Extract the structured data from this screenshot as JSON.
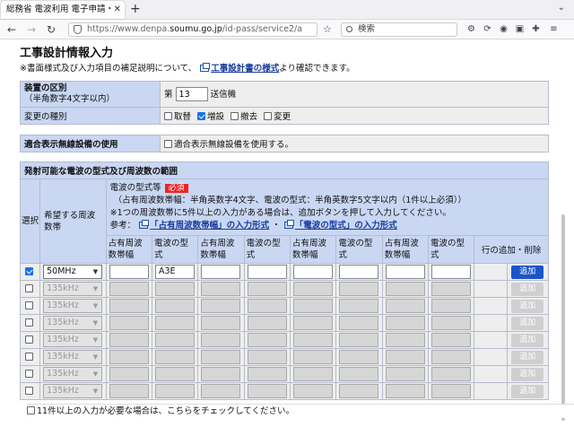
{
  "browser": {
    "tab_title": "総務省 電波利用 電子申請・",
    "url_prefix": "https://www.denpa.",
    "url_domain": "soumu.go.jp",
    "url_suffix": "/id-pass/service2/a",
    "search_placeholder": "検索"
  },
  "page": {
    "title": "工事設計情報入力",
    "notice_before": "※書面様式及び入力項目の補足説明について、",
    "notice_link": "工事設計書の様式",
    "notice_after": "より確認できます。"
  },
  "device": {
    "label_main": "装置の区別",
    "label_sub": "（半角数字4文字以内）",
    "prefix": "第",
    "number": "13",
    "suffix": "送信機"
  },
  "change": {
    "label": "変更の種別",
    "options": [
      {
        "label": "取替",
        "checked": false
      },
      {
        "label": "増設",
        "checked": true
      },
      {
        "label": "撤去",
        "checked": false
      },
      {
        "label": "変更",
        "checked": false
      }
    ]
  },
  "compat": {
    "label": "適合表示無線設備の使用",
    "option": "適合表示無線設備を使用する。"
  },
  "freq": {
    "section_title": "発射可能な電波の型式及び周波数の範囲",
    "col_select": "選択",
    "col_band": "希望する周波数帯",
    "form_label": "電波の型式等",
    "required": "必須",
    "note1": "（占有周波数帯幅：半角英数字4文字、電波の型式：半角英数字5文字以内（1件以上必須））",
    "note2": "※1つの周波数帯に5件以上の入力がある場合は、追加ボタンを押して入力してください。",
    "ref_prefix": "参考：",
    "ref_link1": "「占有周波数帯幅」の入力形式",
    "ref_sep": "・",
    "ref_link2": "「電波の型式」の入力形式",
    "sub_headers": [
      "占有周波数帯幅",
      "電波の型式",
      "占有周波数帯幅",
      "電波の型式",
      "占有周波数帯幅",
      "電波の型式",
      "占有周波数帯幅",
      "電波の型式"
    ],
    "col_action": "行の追加・削除",
    "add_label": "追加",
    "rows": [
      {
        "checked": true,
        "band": "50MHz",
        "enabled": true,
        "values": [
          "",
          "A3E",
          "",
          "",
          "",
          "",
          "",
          ""
        ]
      },
      {
        "checked": false,
        "band": "135kHz",
        "enabled": false,
        "values": [
          "",
          "",
          "",
          "",
          "",
          "",
          "",
          ""
        ]
      },
      {
        "checked": false,
        "band": "135kHz",
        "enabled": false,
        "values": [
          "",
          "",
          "",
          "",
          "",
          "",
          "",
          ""
        ]
      },
      {
        "checked": false,
        "band": "135kHz",
        "enabled": false,
        "values": [
          "",
          "",
          "",
          "",
          "",
          "",
          "",
          ""
        ]
      },
      {
        "checked": false,
        "band": "135kHz",
        "enabled": false,
        "values": [
          "",
          "",
          "",
          "",
          "",
          "",
          "",
          ""
        ]
      },
      {
        "checked": false,
        "band": "135kHz",
        "enabled": false,
        "values": [
          "",
          "",
          "",
          "",
          "",
          "",
          "",
          ""
        ]
      },
      {
        "checked": false,
        "band": "135kHz",
        "enabled": false,
        "values": [
          "",
          "",
          "",
          "",
          "",
          "",
          "",
          ""
        ]
      },
      {
        "checked": false,
        "band": "135kHz",
        "enabled": false,
        "values": [
          "",
          "",
          "",
          "",
          "",
          "",
          "",
          ""
        ]
      }
    ],
    "footer_note": "11件以上の入力が必要な場合は、こちらをチェックしてください。"
  }
}
